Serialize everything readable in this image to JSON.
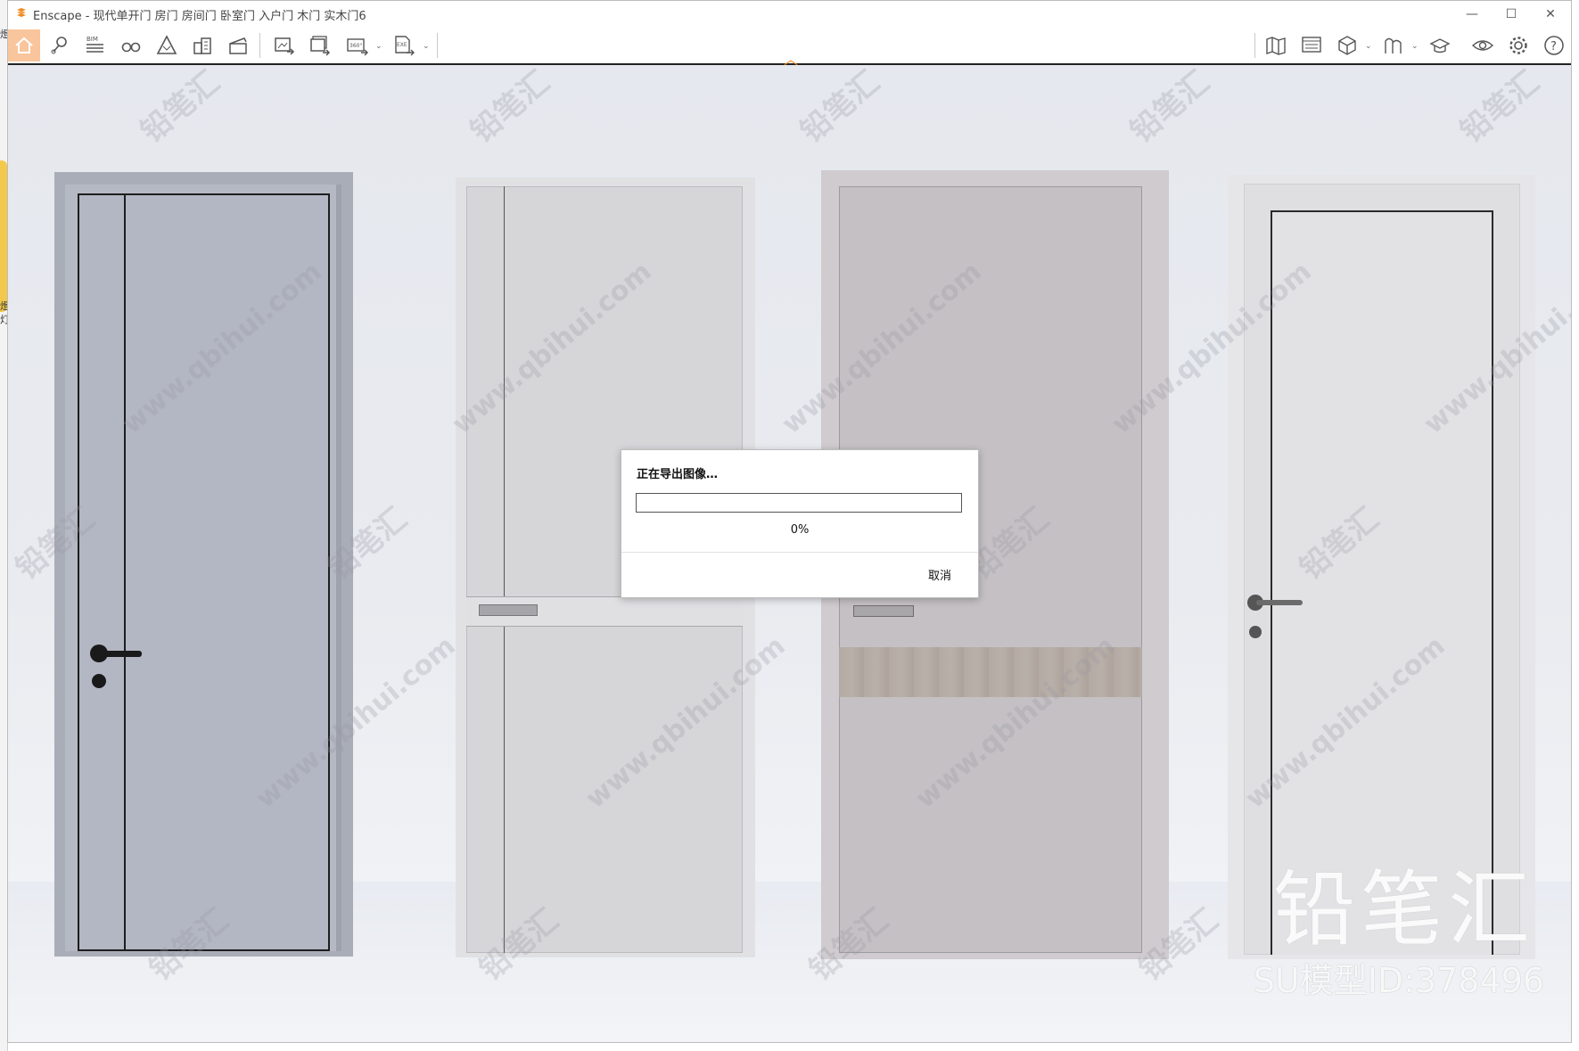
{
  "app": {
    "title": "Enscape - 现代单开门 房门 房间门 卧室门 入户门 木门 实木门6",
    "accent_color": "#f08a24"
  },
  "window_controls": {
    "minimize": "—",
    "maximize": "☐",
    "close": "✕"
  },
  "left_strip": {
    "char1": "燈",
    "char2": "灯"
  },
  "toolbar": {
    "items": [
      {
        "icon": "home-icon",
        "active": true
      },
      {
        "icon": "location-pin-icon"
      },
      {
        "icon": "bim-icon",
        "label": "BIM"
      },
      {
        "icon": "binoculars-icon"
      },
      {
        "icon": "mountain-icon"
      },
      {
        "icon": "buildings-icon"
      },
      {
        "icon": "clapperboard-icon"
      },
      {
        "icon": "export-image-icon"
      },
      {
        "icon": "batch-export-icon"
      },
      {
        "icon": "panorama-360-icon",
        "label": "360°"
      },
      {
        "icon": "export-exe-icon",
        "label": "EXE"
      },
      {
        "icon": "map-icon"
      },
      {
        "icon": "gallery-icon"
      },
      {
        "icon": "cube-icon"
      },
      {
        "icon": "asset-library-icon"
      },
      {
        "icon": "hat-icon"
      },
      {
        "icon": "eye-icon"
      },
      {
        "icon": "gear-icon"
      },
      {
        "icon": "help-icon",
        "label": "?"
      }
    ]
  },
  "dialog": {
    "title": "正在导出图像…",
    "progress_percent": 0,
    "progress_text": "0%",
    "cancel_label": "取消"
  },
  "watermark": {
    "brand": "铅笔汇",
    "model_id": "SU模型ID:378496",
    "site": "www.qbihui.com"
  }
}
